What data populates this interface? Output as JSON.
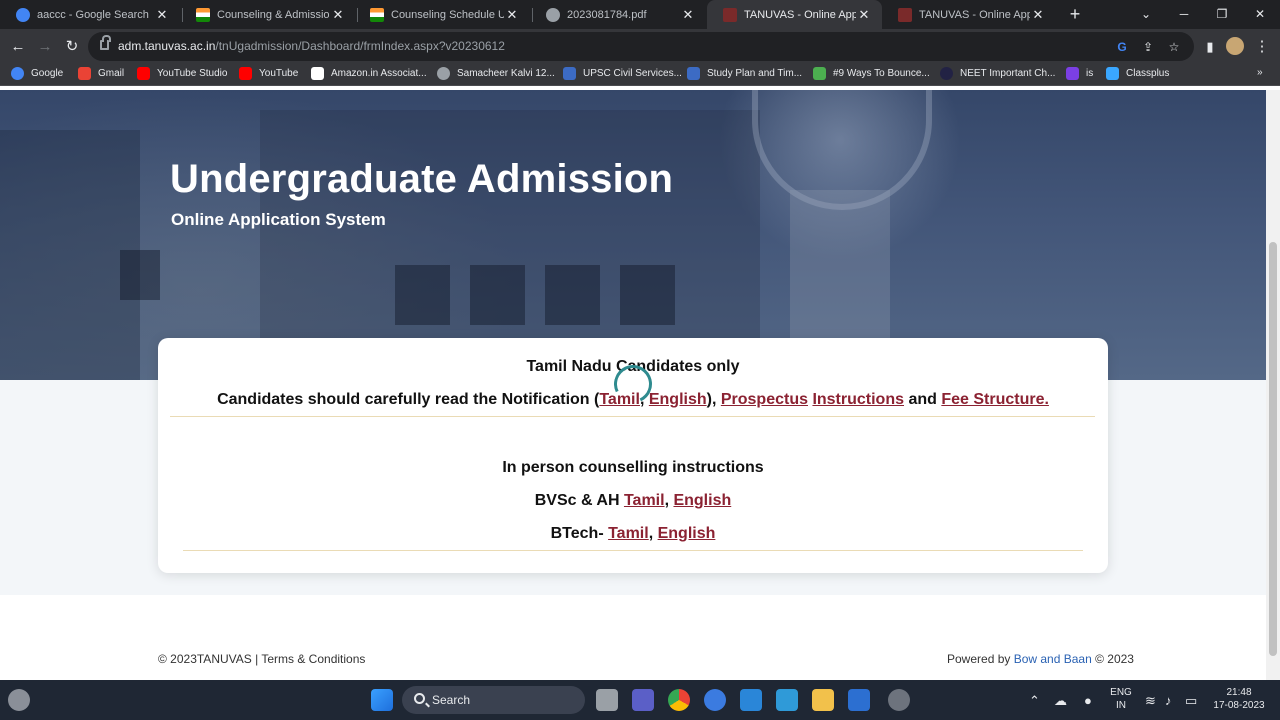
{
  "browser": {
    "tabs": [
      {
        "title": "aaccc - Google Search",
        "favicon_color": "#4285f4"
      },
      {
        "title": "Counseling & Admissions |",
        "favicon_color": "#ff9933"
      },
      {
        "title": "Counseling Schedule UG | A",
        "favicon_color": "#ff9933"
      },
      {
        "title": "2023081784.pdf",
        "favicon_color": "#9aa0a6"
      },
      {
        "title": "TANUVAS - Online Applicati",
        "favicon_color": "#7a2a2a"
      },
      {
        "title": "TANUVAS - Online Applicati",
        "favicon_color": "#7a2a2a"
      }
    ],
    "url_host": "adm.tanuvas.ac.in",
    "url_path": "/tnUgadmission/Dashboard/frmIndex.aspx?v20230612",
    "bookmarks": [
      {
        "label": "Google",
        "color": "#4285f4"
      },
      {
        "label": "Gmail",
        "color": "#ea4335"
      },
      {
        "label": "YouTube Studio",
        "color": "#ff0000"
      },
      {
        "label": "YouTube",
        "color": "#ff0000"
      },
      {
        "label": "Amazon.in Associat...",
        "color": "#ffffff"
      },
      {
        "label": "Samacheer Kalvi 12...",
        "color": "#9aa0a6"
      },
      {
        "label": "UPSC Civil Services...",
        "color": "#3c6bc4"
      },
      {
        "label": "Study Plan and Tim...",
        "color": "#3c6bc4"
      },
      {
        "label": "#9 Ways To Bounce...",
        "color": "#4caf50"
      },
      {
        "label": "NEET Important Ch...",
        "color": "#222244"
      },
      {
        "label": "is",
        "color": "#7b3fe4"
      },
      {
        "label": "Classplus",
        "color": "#3aa7ff"
      }
    ]
  },
  "hero": {
    "title": "Undergraduate Admission",
    "subtitle": "Online Application System"
  },
  "card": {
    "line1": "Tamil Nadu Candidates only",
    "notice_prefix": "Candidates should carefully read the Notification (",
    "notice_tamil": "Tamil",
    "notice_comma": ", ",
    "notice_english": "English",
    "notice_close": "), ",
    "notice_prospectus": "Prospectus",
    "notice_space": " ",
    "notice_instructions": "Instructions",
    "notice_and": " and ",
    "notice_fee": "Fee Structure.",
    "counselling_title": "In person counselling instructions",
    "bvsc_prefix": "BVSc & AH ",
    "bvsc_tamil": "Tamil",
    "bvsc_comma": ", ",
    "bvsc_english": "English",
    "btech_prefix": "BTech- ",
    "btech_tamil": "Tamil",
    "btech_comma": ", ",
    "btech_english": "English"
  },
  "footer": {
    "left": "© 2023TANUVAS | Terms & Conditions",
    "right_prefix": "Powered by ",
    "right_brand": "Bow and Baan",
    "right_suffix": " © 2023"
  },
  "taskbar": {
    "search_label": "Search",
    "lang_line1": "ENG",
    "lang_line2": "IN",
    "time": "21:48",
    "date": "17-08-2023"
  }
}
